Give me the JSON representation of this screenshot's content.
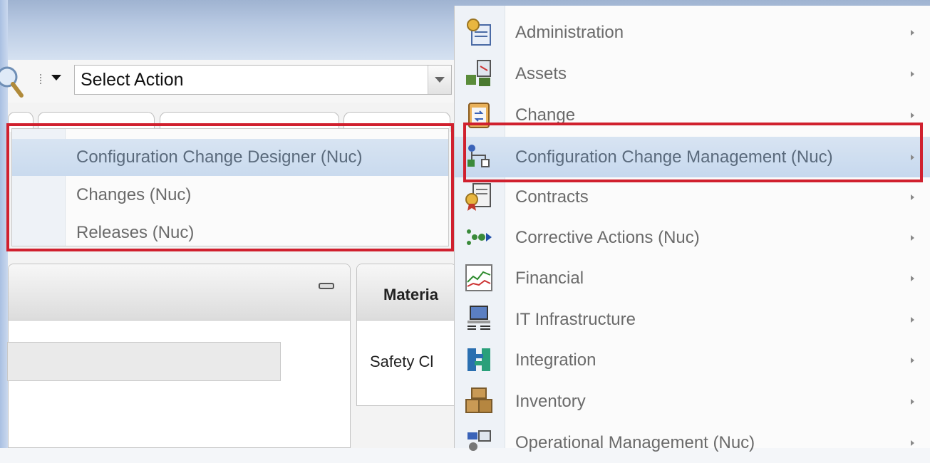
{
  "toolbar": {
    "select_action_label": "Select Action"
  },
  "submenu": {
    "items": [
      {
        "label": "Configuration Change Designer (Nuc)"
      },
      {
        "label": "Changes (Nuc)"
      },
      {
        "label": "Releases (Nuc)"
      }
    ]
  },
  "portlets": {
    "right_title": "Materia",
    "right_text": "Safety Cl"
  },
  "main_menu": {
    "items": [
      {
        "label": "Administration",
        "icon": "key-document-icon"
      },
      {
        "label": "Assets",
        "icon": "assets-icon"
      },
      {
        "label": "Change",
        "icon": "clipboard-change-icon"
      },
      {
        "label": "Configuration Change Management (Nuc)",
        "icon": "configuration-nodes-icon"
      },
      {
        "label": "Contracts",
        "icon": "contract-ribbon-icon"
      },
      {
        "label": "Corrective Actions (Nuc)",
        "icon": "corrective-actions-icon"
      },
      {
        "label": "Financial",
        "icon": "financial-chart-icon"
      },
      {
        "label": "IT Infrastructure",
        "icon": "computer-icon"
      },
      {
        "label": "Integration",
        "icon": "integration-icon"
      },
      {
        "label": "Inventory",
        "icon": "boxes-icon"
      },
      {
        "label": "Operational Management (Nuc)",
        "icon": "operations-icon"
      }
    ]
  },
  "colors": {
    "highlight_box": "#d0202e",
    "menu_highlight": "#c9daee"
  }
}
